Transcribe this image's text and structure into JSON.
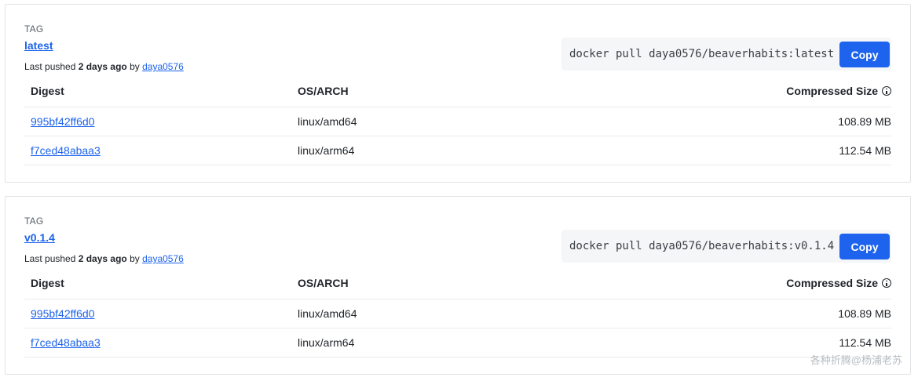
{
  "tags": [
    {
      "label": "TAG",
      "name": "latest",
      "pushed_prefix": "Last pushed ",
      "pushed_ago": "2 days ago",
      "pushed_by": " by ",
      "user": "daya0576",
      "pull_command": "docker pull daya0576/beaverhabits:latest",
      "copy_label": "Copy",
      "columns": {
        "digest": "Digest",
        "arch": "OS/ARCH",
        "size": "Compressed Size"
      },
      "rows": [
        {
          "digest": "995bf42ff6d0",
          "arch": "linux/amd64",
          "size": "108.89 MB"
        },
        {
          "digest": "f7ced48abaa3",
          "arch": "linux/arm64",
          "size": "112.54 MB"
        }
      ]
    },
    {
      "label": "TAG",
      "name": "v0.1.4",
      "pushed_prefix": "Last pushed ",
      "pushed_ago": "2 days ago",
      "pushed_by": " by ",
      "user": "daya0576",
      "pull_command": "docker pull daya0576/beaverhabits:v0.1.4",
      "copy_label": "Copy",
      "columns": {
        "digest": "Digest",
        "arch": "OS/ARCH",
        "size": "Compressed Size"
      },
      "rows": [
        {
          "digest": "995bf42ff6d0",
          "arch": "linux/amd64",
          "size": "108.89 MB"
        },
        {
          "digest": "f7ced48abaa3",
          "arch": "linux/arm64",
          "size": "112.54 MB"
        }
      ]
    }
  ],
  "watermark": "各种折腾@杨浦老苏",
  "icons": {
    "size_info": "info-icon"
  },
  "colors": {
    "link": "#1d63ed",
    "button": "#1d63ed"
  }
}
